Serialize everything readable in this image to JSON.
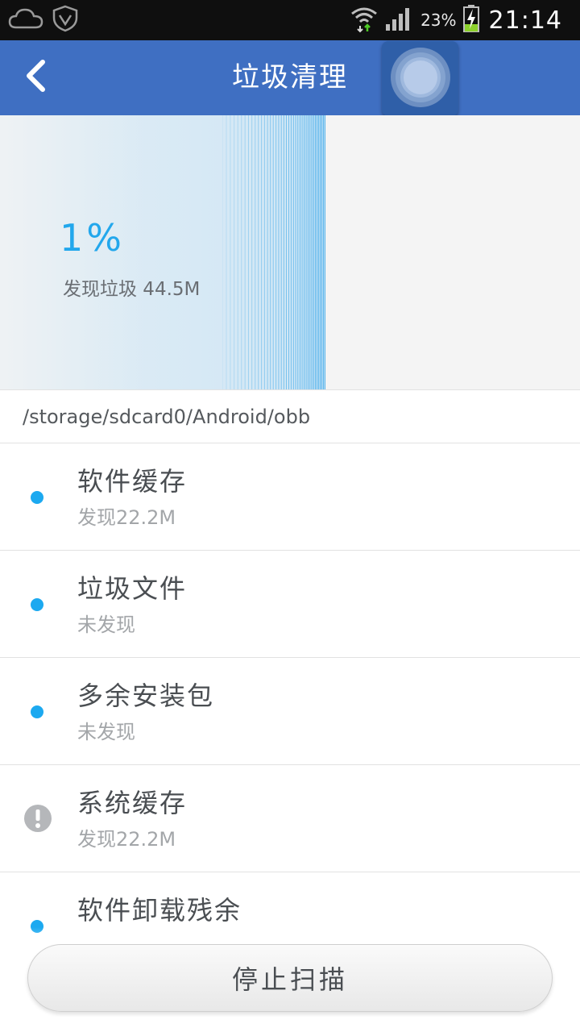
{
  "status_bar": {
    "battery_percent": "23%",
    "time": "21:14",
    "icons": [
      "cloud-icon",
      "shield-icon",
      "wifi-icon",
      "signal-icon",
      "battery-charging-icon"
    ]
  },
  "header": {
    "title": "垃圾清理",
    "back_icon": "back-arrow-icon",
    "floating_icon": "floating-circle-icon"
  },
  "scan": {
    "percent_label": "1%",
    "progress": 0.01,
    "found_label": "发现垃圾 44.5M"
  },
  "path": "/storage/sdcard0/Android/obb",
  "items": [
    {
      "title": "软件缓存",
      "subtitle": "发现22.2M",
      "indicator": "dot"
    },
    {
      "title": "垃圾文件",
      "subtitle": "未发现",
      "indicator": "dot"
    },
    {
      "title": "多余安装包",
      "subtitle": "未发现",
      "indicator": "dot"
    },
    {
      "title": "系统缓存",
      "subtitle": "发现22.2M",
      "indicator": "warning"
    },
    {
      "title": "软件卸载残余",
      "subtitle": "",
      "indicator": "dot"
    }
  ],
  "button": {
    "label": "停止扫描"
  },
  "colors": {
    "actionbar": "#3f6fc2",
    "accent": "#22a7ec",
    "dot": "#1ca9f0",
    "warning": "#b5b7ba"
  }
}
